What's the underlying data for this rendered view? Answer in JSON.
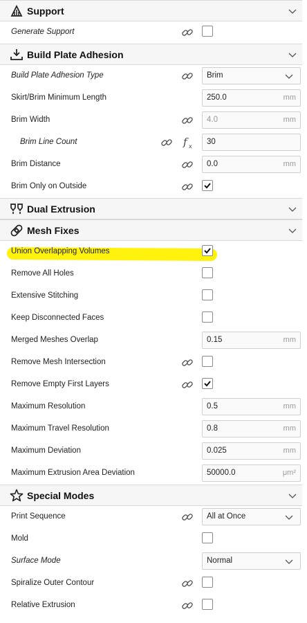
{
  "support": {
    "title": "Support",
    "generate_support": "Generate Support"
  },
  "adhesion": {
    "title": "Build Plate Adhesion",
    "type_label": "Build Plate Adhesion Type",
    "type_value": "Brim",
    "skirt_label": "Skirt/Brim Minimum Length",
    "skirt_value": "250.0",
    "brim_width_label": "Brim Width",
    "brim_width_value": "4.0",
    "brim_line_count_label": "Brim Line Count",
    "brim_line_count_value": "30",
    "brim_distance_label": "Brim Distance",
    "brim_distance_value": "0.0",
    "brim_only_outside_label": "Brim Only on Outside"
  },
  "dual": {
    "title": "Dual Extrusion"
  },
  "mesh": {
    "title": "Mesh Fixes",
    "union_label": "Union Overlapping Volumes",
    "remove_holes_label": "Remove All Holes",
    "extensive_label": "Extensive Stitching",
    "keep_disconnected_label": "Keep Disconnected Faces",
    "merged_overlap_label": "Merged Meshes Overlap",
    "merged_overlap_value": "0.15",
    "remove_intersection_label": "Remove Mesh Intersection",
    "remove_empty_label": "Remove Empty First Layers",
    "max_res_label": "Maximum Resolution",
    "max_res_value": "0.5",
    "max_travel_label": "Maximum Travel Resolution",
    "max_travel_value": "0.8",
    "max_dev_label": "Maximum Deviation",
    "max_dev_value": "0.025",
    "max_area_label": "Maximum Extrusion Area Deviation",
    "max_area_value": "50000.0"
  },
  "special": {
    "title": "Special Modes",
    "print_seq_label": "Print Sequence",
    "print_seq_value": "All at Once",
    "mold_label": "Mold",
    "surface_label": "Surface Mode",
    "surface_value": "Normal",
    "spiralize_label": "Spiralize Outer Contour",
    "relative_label": "Relative Extrusion"
  },
  "units": {
    "mm": "mm",
    "um2": "μm²"
  },
  "checkboxes": {
    "generate_support": false,
    "brim_only_outside": true,
    "union_overlapping": true,
    "remove_all_holes": false,
    "extensive_stitching": false,
    "keep_disconnected": false,
    "remove_mesh_intersection": false,
    "remove_empty_first_layers": true,
    "mold": false,
    "spiralize": false,
    "relative_extrusion": false
  },
  "colors": {
    "highlight": "#fff200",
    "category_bg": "#f6f6f6",
    "field_bg": "#fafafa"
  },
  "icons": [
    "support-icon",
    "adhesion-icon",
    "dual-extrusion-icon",
    "mesh-fixes-icon",
    "special-modes-icon",
    "link-icon",
    "function-icon",
    "chevron-down-icon"
  ]
}
